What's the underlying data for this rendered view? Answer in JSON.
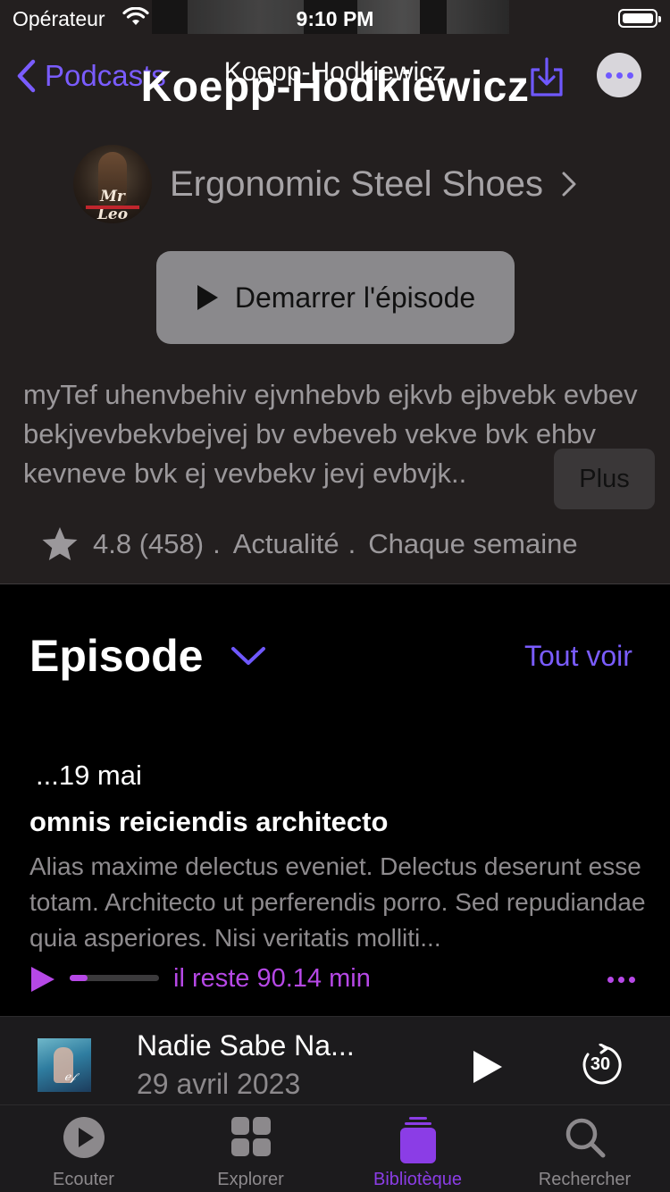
{
  "status_bar": {
    "carrier": "Opérateur",
    "time": "9:10 PM"
  },
  "nav": {
    "back_label": "Podcasts",
    "title_small": "Koepp-Hodkiewicz",
    "title_large": "Koepp-Hodkiewicz"
  },
  "show": {
    "name": "Ergonomic Steel Shoes",
    "art_label": "Mr Leo"
  },
  "play_episode": {
    "label": "Demarrer l'épisode"
  },
  "description": {
    "text": "myTef uhenvbehiv ejvnhebvb ejkvb ejbvebk evbev bekjvevbekvbejvej bv evbeveb vekve bvk ehbv kevneve bvk ej vevbekv jevj evbvjk..",
    "more_label": "Plus"
  },
  "meta": {
    "rating": "4.8 (458)",
    "sep1": ".",
    "category": "Actualité",
    "sep2": ".",
    "frequency": "Chaque semaine"
  },
  "episodes": {
    "heading": "Episode",
    "see_all_label": "Tout voir",
    "items": [
      {
        "date": "...19 mai",
        "title": "omnis reiciendis architecto",
        "description": "Alias maxime delectus eveniet. Delectus deserunt esse totam. Architecto ut perferendis porro. Sed repudiandae quia asperiores. Nisi veritatis molliti...",
        "remaining": "il reste 90.14 min",
        "progress": 0.2
      }
    ]
  },
  "mini_player": {
    "title": "Nadie Sabe Na...",
    "date": "29 avril 2023",
    "skip_seconds": "30"
  },
  "tabs": [
    {
      "label": "Ecouter",
      "icon": "play-circle-icon",
      "active": false
    },
    {
      "label": "Explorer",
      "icon": "grid-icon",
      "active": false
    },
    {
      "label": "Bibliotèque",
      "icon": "library-stack-icon",
      "active": true
    },
    {
      "label": "Rechercher",
      "icon": "search-icon",
      "active": false
    }
  ],
  "colors": {
    "accent": "#7a5cff",
    "episode_accent": "#b648e6",
    "active_tab": "#8b3de6",
    "header_background": "#231f1f"
  }
}
